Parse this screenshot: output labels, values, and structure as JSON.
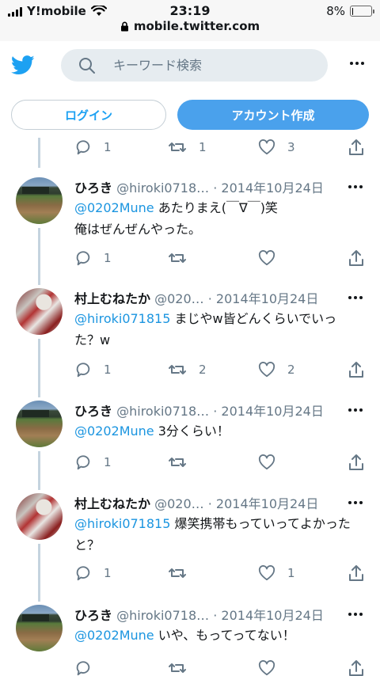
{
  "statusbar": {
    "carrier": "Y!mobile",
    "time": "23:19",
    "url": "mobile.twitter.com",
    "battery": "8%",
    "battery_level": 0.08
  },
  "header": {
    "search_placeholder": "キーワード検索",
    "login_label": "ログイン",
    "signup_label": "アカウント作成"
  },
  "top_partial": {
    "reply": "1",
    "retweet": "1",
    "like": "3"
  },
  "tweets": [
    {
      "name": "ひろき",
      "handle": "@hiroki0718…",
      "date": "2014年10月24日",
      "mention": "@0202Mune",
      "text_line1": " あたりまえ(￣∇￣)笑",
      "text_line2": "俺はぜんぜんやった。",
      "reply": "1",
      "retweet": "",
      "like": ""
    },
    {
      "name": "村上むねたか",
      "handle": "@020…",
      "date": "2014年10月24日",
      "mention": "@hiroki071815",
      "text_line1": " まじやw皆どんくらいでいっ",
      "text_line2": "た？w",
      "reply": "1",
      "retweet": "2",
      "like": "2"
    },
    {
      "name": "ひろき",
      "handle": "@hiroki0718…",
      "date": "2014年10月24日",
      "mention": "@0202Mune",
      "text_line1": " 3分くらい！",
      "text_line2": "",
      "reply": "1",
      "retweet": "",
      "like": ""
    },
    {
      "name": "村上むねたか",
      "handle": "@020…",
      "date": "2014年10月24日",
      "mention": "@hiroki071815",
      "text_line1": " 爆笑携帯もっていってよかった",
      "text_line2": "と？",
      "reply": "1",
      "retweet": "",
      "like": "1"
    },
    {
      "name": "ひろき",
      "handle": "@hiroki0718…",
      "date": "2014年10月24日",
      "mention": "@0202Mune",
      "text_line1": " いや、もってってない！",
      "text_line2": "",
      "reply": "",
      "retweet": "",
      "like": ""
    }
  ],
  "separator": " · ",
  "colors": {
    "accent": "#1da1f2",
    "signup_bg": "#4aa1ec",
    "muted": "#657786",
    "thread": "#c5d4df"
  }
}
